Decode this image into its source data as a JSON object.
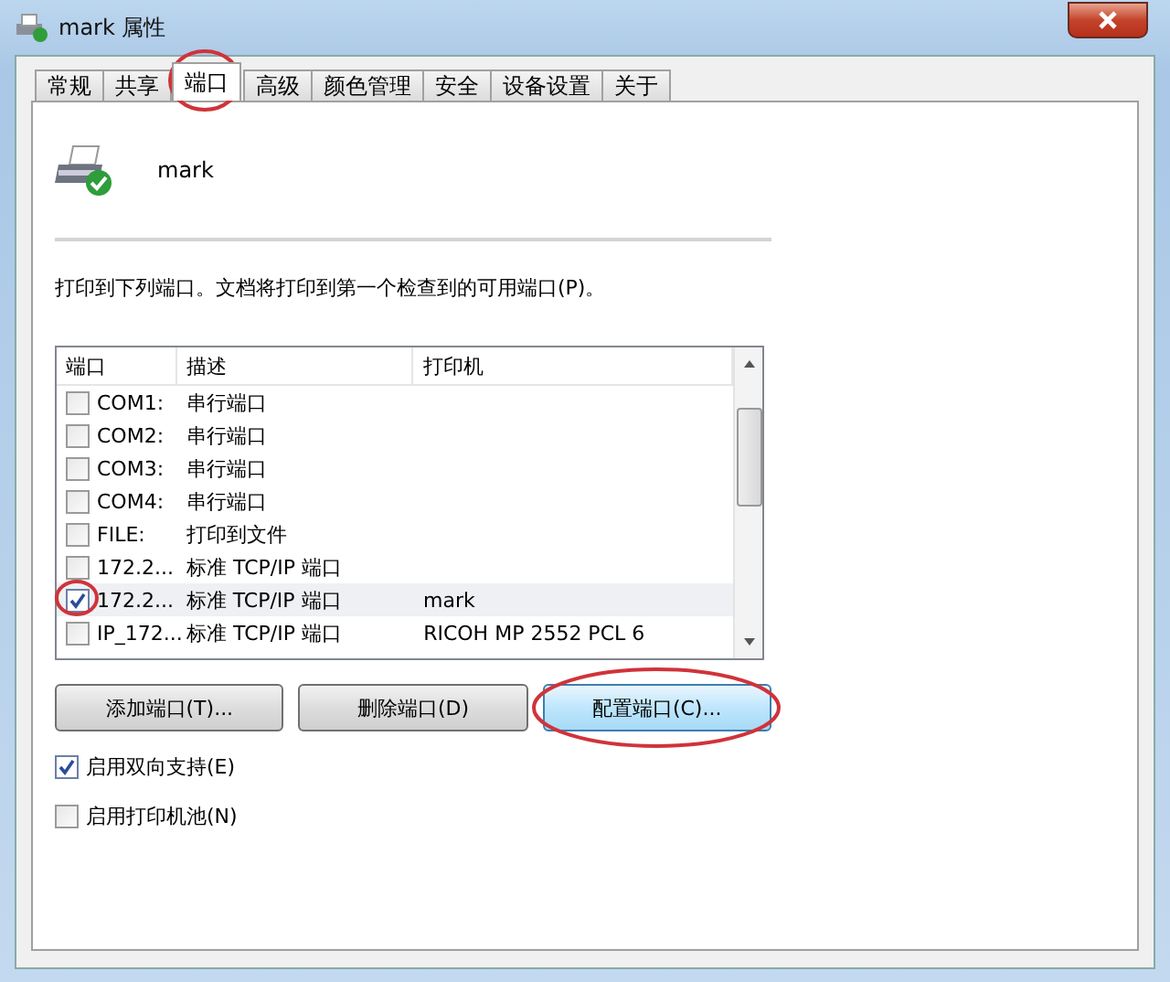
{
  "window": {
    "title": "mark 属性"
  },
  "tabs": [
    {
      "label": "常规",
      "selected": false
    },
    {
      "label": "共享",
      "selected": false
    },
    {
      "label": "端口",
      "selected": true
    },
    {
      "label": "高级",
      "selected": false
    },
    {
      "label": "颜色管理",
      "selected": false
    },
    {
      "label": "安全",
      "selected": false
    },
    {
      "label": "设备设置",
      "selected": false
    },
    {
      "label": "关于",
      "selected": false
    }
  ],
  "printer_name": "mark",
  "instruction": "打印到下列端口。文档将打印到第一个检查到的可用端口(P)。",
  "port_list": {
    "columns": [
      "端口",
      "描述",
      "打印机"
    ],
    "rows": [
      {
        "port": "COM1:",
        "description": "串行端口",
        "printer": "",
        "checked": false,
        "selected": false
      },
      {
        "port": "COM2:",
        "description": "串行端口",
        "printer": "",
        "checked": false,
        "selected": false
      },
      {
        "port": "COM3:",
        "description": "串行端口",
        "printer": "",
        "checked": false,
        "selected": false
      },
      {
        "port": "COM4:",
        "description": "串行端口",
        "printer": "",
        "checked": false,
        "selected": false
      },
      {
        "port": "FILE:",
        "description": "打印到文件",
        "printer": "",
        "checked": false,
        "selected": false
      },
      {
        "port": "172.2...",
        "description": "标准 TCP/IP 端口",
        "printer": "",
        "checked": false,
        "selected": false
      },
      {
        "port": "172.2...",
        "description": "标准 TCP/IP 端口",
        "printer": "mark",
        "checked": true,
        "selected": true
      },
      {
        "port": "IP_172...",
        "description": "标准 TCP/IP 端口",
        "printer": "RICOH MP 2552 PCL 6",
        "checked": false,
        "selected": false
      }
    ]
  },
  "buttons": [
    {
      "label": "添加端口(T)...",
      "focused": false
    },
    {
      "label": "删除端口(D)",
      "focused": false
    },
    {
      "label": "配置端口(C)...",
      "focused": true
    }
  ],
  "options": [
    {
      "label": "启用双向支持(E)",
      "checked": true
    },
    {
      "label": "启用打印机池(N)",
      "checked": false
    }
  ]
}
